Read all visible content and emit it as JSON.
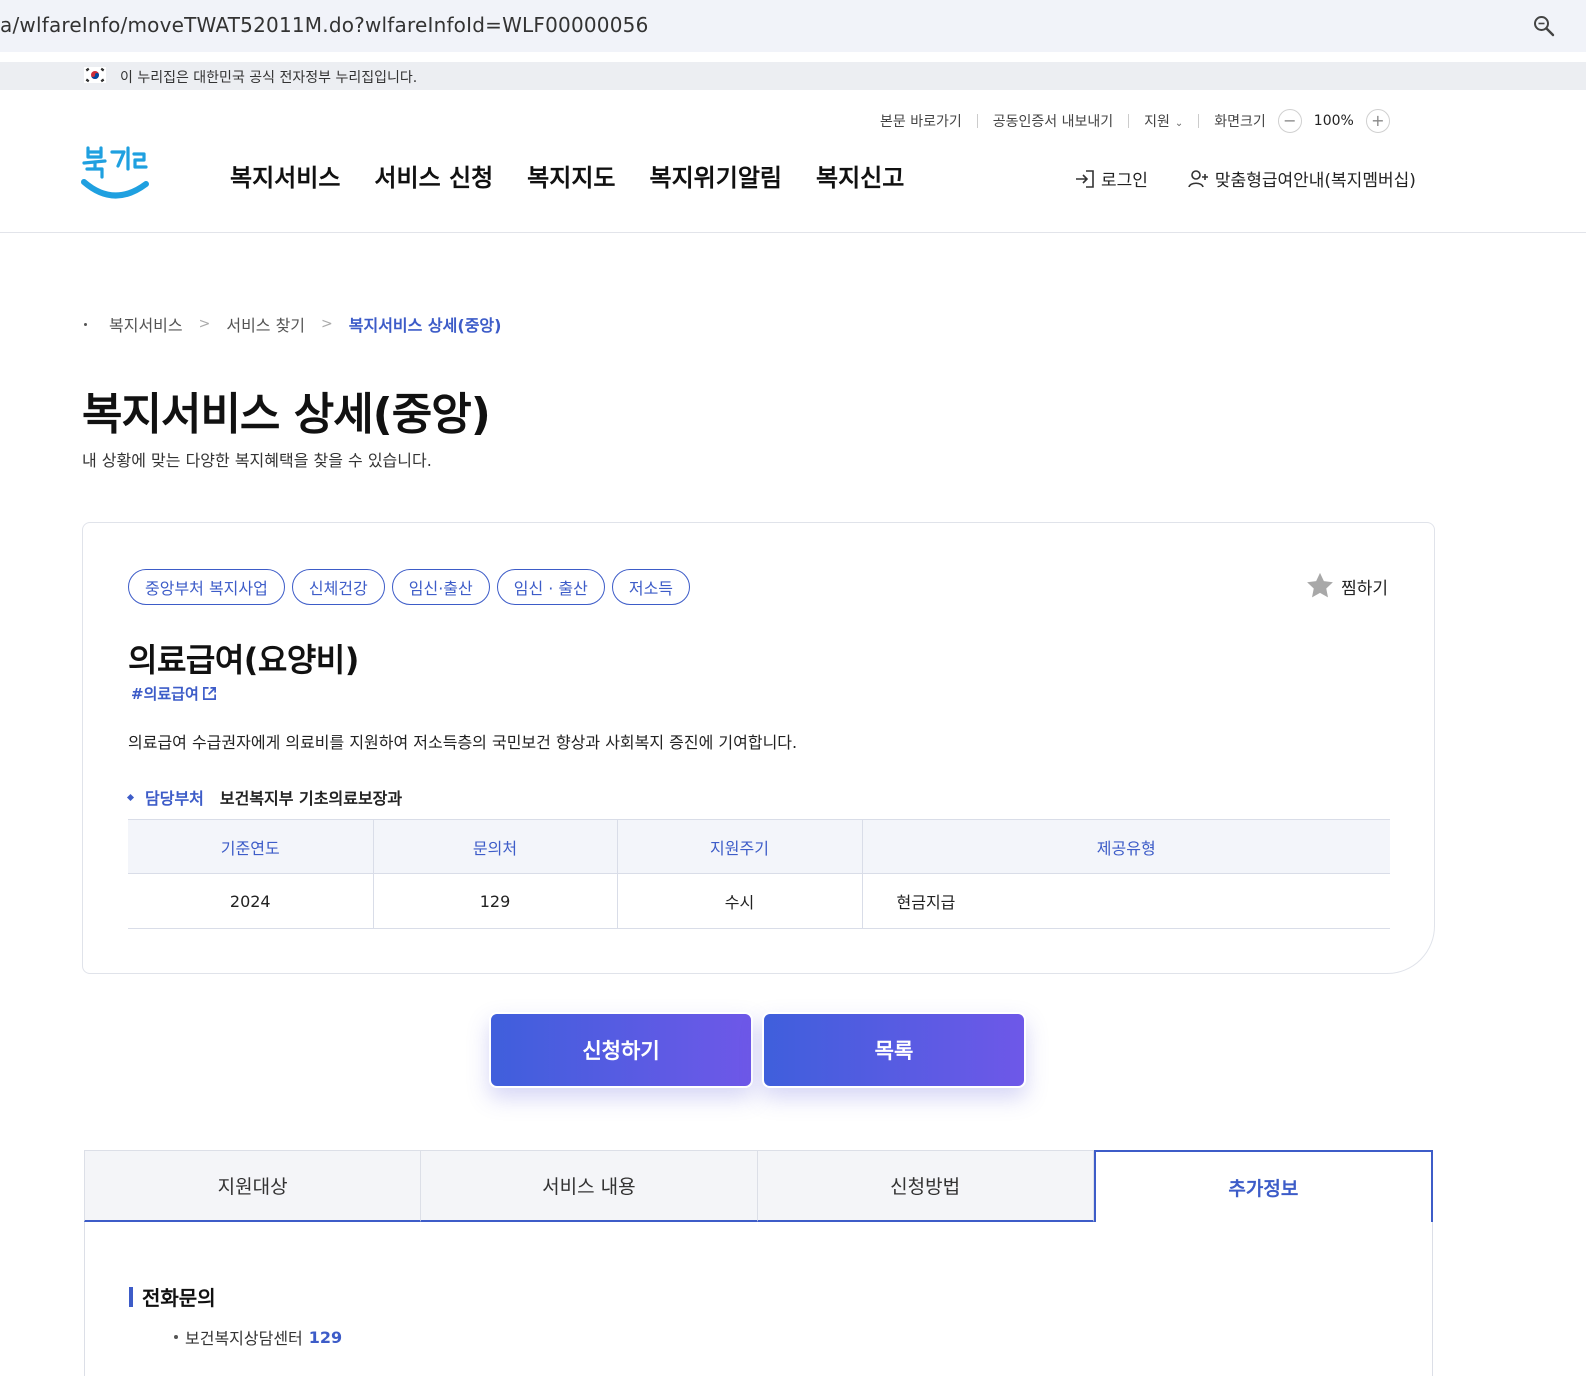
{
  "browser": {
    "url": "a/wlfareInfo/moveTWAT52011M.do?wlfareInfoId=WLF00000056"
  },
  "gov_banner": {
    "text": "이 누리집은 대한민국 공식 전자정부 누리집입니다."
  },
  "utility_nav": {
    "skip": "본문 바로가기",
    "cert": "공동인증서 내보내기",
    "support": "지원",
    "screen_size": "화면크기",
    "zoom": "100%",
    "minus": "−",
    "plus": "+"
  },
  "header": {
    "logo_text": "복지로",
    "menu": [
      "복지서비스",
      "서비스 신청",
      "복지지도",
      "복지위기알림",
      "복지신고"
    ],
    "login": "로그인",
    "membership": "맞춤형급여안내(복지멤버십)"
  },
  "breadcrumb": [
    "복지서비스",
    "서비스 찾기",
    "복지서비스 상세(중앙)"
  ],
  "page": {
    "title": "복지서비스 상세(중앙)",
    "subtitle": "내 상황에 맞는 다양한 복지혜택을 찾을 수 있습니다."
  },
  "service": {
    "tags": [
      "중앙부처 복지사업",
      "신체건강",
      "임신·출산",
      "임신 · 출산",
      "저소득"
    ],
    "bookmark_label": "찜하기",
    "name": "의료급여(요양비)",
    "hashtag": "#의료급여",
    "description": "의료급여 수급권자에게 의료비를 지원하여 저소득층의 국민보건 향상과 사회복지 증진에 기여합니다.",
    "dept_label": "담당부처",
    "dept_value": "보건복지부 기초의료보장과",
    "table": {
      "headers": [
        "기준연도",
        "문의처",
        "지원주기",
        "제공유형"
      ],
      "row": [
        "2024",
        "129",
        "수시",
        "현금지급"
      ]
    }
  },
  "buttons": {
    "apply": "신청하기",
    "list": "목록"
  },
  "tabs": [
    {
      "label": "지원대상",
      "active": false
    },
    {
      "label": "서비스 내용",
      "active": false
    },
    {
      "label": "신청방법",
      "active": false
    },
    {
      "label": "추가정보",
      "active": true
    }
  ],
  "extra_info": {
    "section_title": "전화문의",
    "contact_name": "보건복지상담센터",
    "contact_number": "129"
  },
  "colors": {
    "accent": "#3d5cc8",
    "button_gradient_start": "#3f5fdc",
    "button_gradient_end": "#6e58e8"
  }
}
